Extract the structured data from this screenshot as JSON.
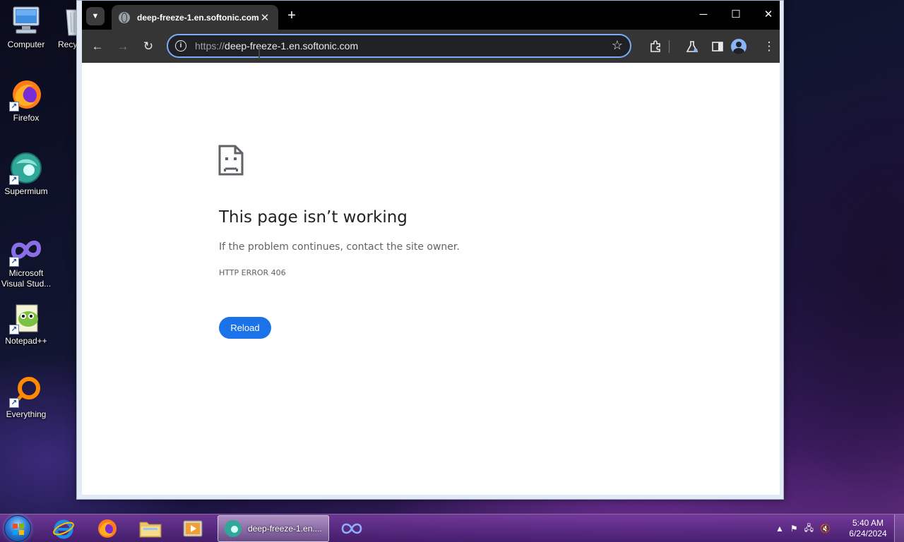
{
  "desktop": {
    "icons": [
      {
        "label": "Computer"
      },
      {
        "label": "Recy"
      },
      {
        "label": "Firefox"
      },
      {
        "label": "Supermium"
      },
      {
        "label": "Microsoft Visual Stud..."
      },
      {
        "label": "Notepad++"
      },
      {
        "label": "Everything"
      }
    ]
  },
  "browser": {
    "tab": {
      "title": "deep-freeze-1.en.softonic.com"
    },
    "address_bar": {
      "scheme": "https://",
      "host": "deep-freeze-1.en.softonic.com"
    },
    "page": {
      "title": "This page isn’t working",
      "description": "If the problem continues, contact the site owner.",
      "error_code": "HTTP ERROR 406",
      "reload_label": "Reload"
    }
  },
  "taskbar": {
    "active_window_label": "deep-freeze-1.en....",
    "clock_time": "5:40 AM",
    "clock_date": "6/24/2024"
  }
}
